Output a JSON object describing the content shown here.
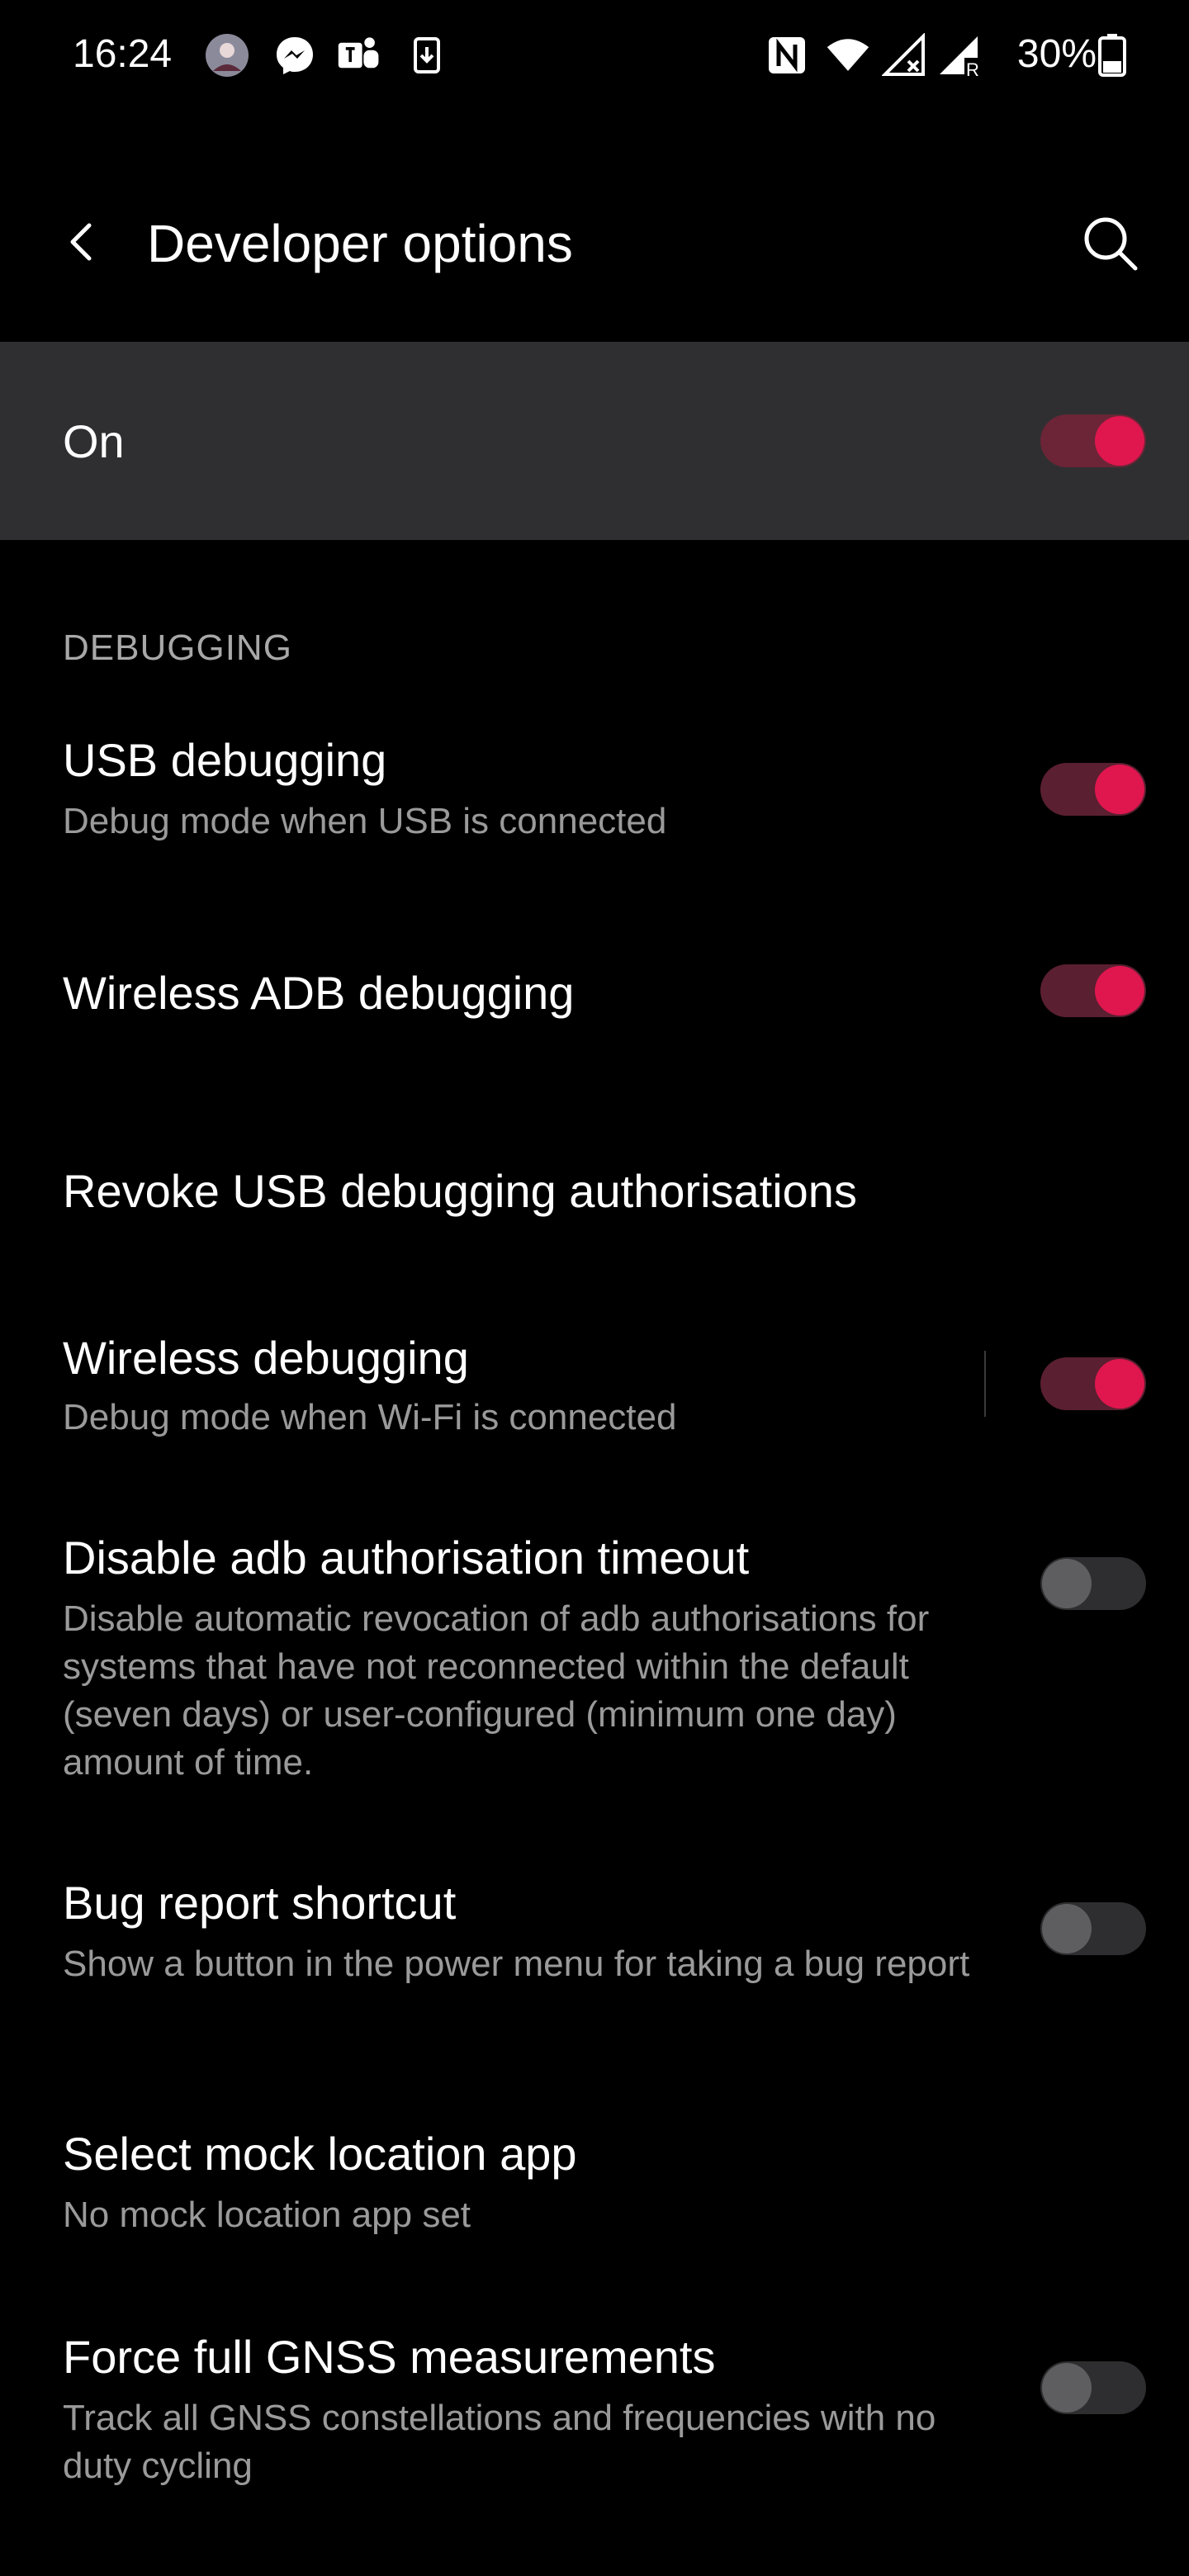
{
  "status_bar": {
    "time": "16:24",
    "battery": "30%",
    "left_icons": [
      "avatar-icon",
      "messenger-icon",
      "teams-icon",
      "download-icon"
    ],
    "right_icons": [
      "nfc-icon",
      "wifi-icon",
      "signal-x-icon",
      "signal-roaming-icon",
      "battery-icon"
    ]
  },
  "app_bar": {
    "title": "Developer options",
    "back_icon": "back-arrow-icon",
    "search_icon": "search-icon"
  },
  "master_switch": {
    "label": "On",
    "state": "on"
  },
  "section": {
    "header": "DEBUGGING"
  },
  "settings": [
    {
      "title": "USB debugging",
      "summary": "Debug mode when USB is connected",
      "toggle": "on"
    },
    {
      "title": "Wireless ADB debugging",
      "toggle": "on"
    },
    {
      "title": "Revoke USB debugging authorisations"
    },
    {
      "title": "Wireless debugging",
      "summary": "Debug mode when Wi-Fi is connected",
      "toggle": "on"
    },
    {
      "title": "Disable adb authorisation timeout",
      "summary": "Disable automatic revocation of adb authorisations for systems that have not reconnected within the default (seven days) or user-configured (minimum one day) amount of time.",
      "toggle": "off"
    },
    {
      "title": "Bug report shortcut",
      "summary": "Show a button in the power menu for taking a bug report",
      "toggle": "off"
    },
    {
      "title": "Select mock location app",
      "summary": "No mock location app set"
    },
    {
      "title": "Force full GNSS measurements",
      "summary": "Track all GNSS constellations and frequencies with no duty cycling",
      "toggle": "off"
    }
  ],
  "colors": {
    "accent": "#e0164f",
    "background": "#000000",
    "master_bar": "#2f2f31"
  }
}
